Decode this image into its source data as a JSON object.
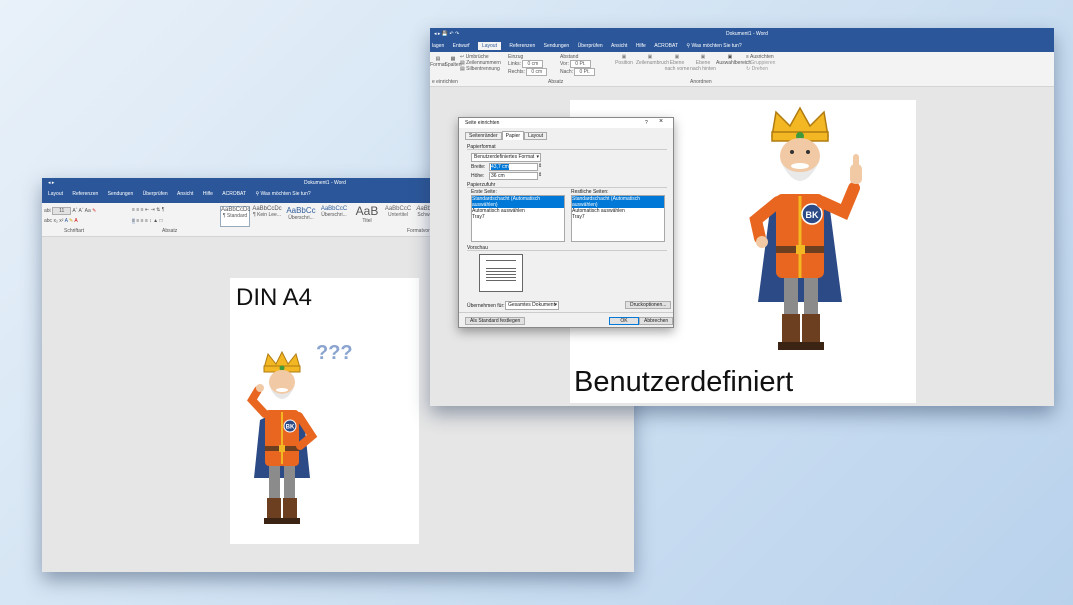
{
  "left_window": {
    "title": "Dokument1 - Word",
    "tabs": [
      "Layout",
      "Referenzen",
      "Sendungen",
      "Überprüfen",
      "Ansicht",
      "Hilfe",
      "ACROBAT"
    ],
    "tell_me": "Was möchten Sie tun?",
    "font_size": "11",
    "styles": [
      {
        "preview": "AaBbCcDc",
        "name": "¶ Standard"
      },
      {
        "preview": "AaBbCcDc",
        "name": "¶ Kein Lee..."
      },
      {
        "preview": "AaBbCc",
        "name": "Überschri..."
      },
      {
        "preview": "AaBbCcC",
        "name": "Überschri..."
      },
      {
        "preview": "AaB",
        "name": "Titel"
      },
      {
        "preview": "AaBbCcC",
        "name": "Untertitel"
      },
      {
        "preview": "AaBbCcDc",
        "name": "Schwache..."
      }
    ],
    "groups": [
      "Schriftart",
      "Absatz",
      "Formatvorl"
    ],
    "page_label": "DIN A4"
  },
  "right_window": {
    "title": "Dokument1 - Word",
    "tabs": [
      "lagen",
      "Entwurf",
      "Layout",
      "Referenzen",
      "Sendungen",
      "Überprüfen",
      "Ansicht",
      "Hilfe",
      "ACROBAT"
    ],
    "active_tab": "Layout",
    "tell_me": "Was möchten Sie tun?",
    "ribbon": {
      "umbrueche": "Umbrüche",
      "zeilennummern": "Zeilennummern",
      "silbentrennung": "Silbentrennung",
      "format": "Format",
      "spalten": "Spalten",
      "einzug": "Einzug",
      "abstand": "Abstand",
      "links_label": "Links:",
      "links_val": "0 cm",
      "rechts_label": "Rechts:",
      "rechts_val": "0 cm",
      "vor_label": "Vor:",
      "vor_val": "0 Pt.",
      "nach_label": "Nach:",
      "nach_val": "0 Pt.",
      "position": "Position",
      "zeilenumbruch": "Zeilenumbruch",
      "ebene_nach_vorne": "Ebene nach vorne",
      "ebene_nach_hinten": "Ebene nach hinten",
      "auswahlbereich": "Auswahlbereich",
      "ausrichten": "Ausrichten",
      "gruppieren": "Gruppieren",
      "drehen": "Drehen",
      "group_einrichten": "e einrichten",
      "group_absatz": "Absatz",
      "group_anordnen": "Anordnen"
    },
    "page_label": "Benutzerdefiniert"
  },
  "dialog": {
    "title": "Seite einrichten",
    "help": "?",
    "close": "×",
    "tabs": [
      "Seitenränder",
      "Papier",
      "Layout"
    ],
    "active_tab": "Papier",
    "papierformat_label": "Papierformat",
    "papierformat_value": "Benutzerdefiniertes Format",
    "breite_label": "Breite:",
    "breite_value": "43,7 cm",
    "hoehe_label": "Höhe:",
    "hoehe_value": "36 cm",
    "papierzufuhr_label": "Papierzufuhr",
    "erste_seite_label": "Erste Seite:",
    "erste_seite_items": [
      "Standardschacht (Automatisch auswählen)",
      "Automatisch auswählen",
      "Tray7"
    ],
    "restliche_label": "Restliche Seiten:",
    "restliche_items": [
      "Standardschacht (Automatisch auswählen)",
      "Automatisch auswählen",
      "Tray7"
    ],
    "vorschau_label": "Vorschau",
    "uebernehmen_label": "Übernehmen für:",
    "uebernehmen_value": "Gesamtes Dokument",
    "druckoptionen": "Druckoptionen...",
    "als_standard": "Als Standard festlegen",
    "ok": "OK",
    "abbrechen": "Abbrechen"
  },
  "question_marks": "???",
  "badge": "BK",
  "colors": {
    "word_blue": "#2b579a",
    "orange": "#e8661f",
    "cape": "#2c4a86",
    "gold": "#f2b722",
    "brown": "#6d3f21"
  }
}
